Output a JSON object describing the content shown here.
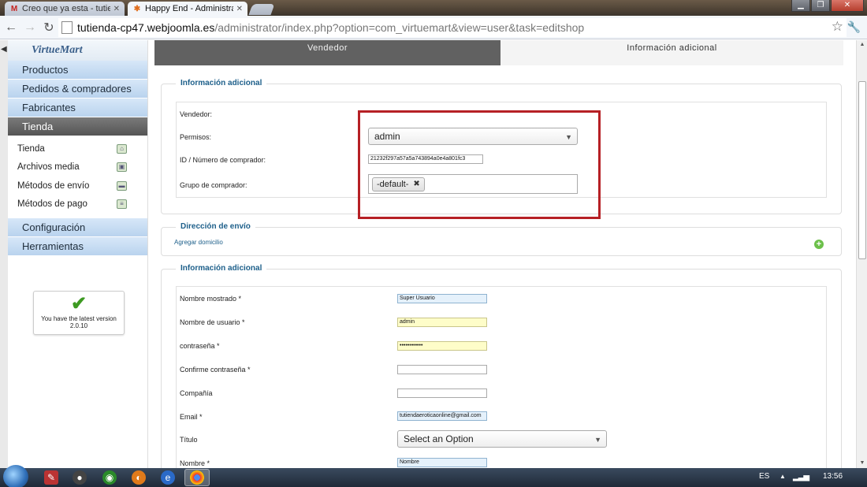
{
  "browser": {
    "tabs": [
      {
        "title": "Creo que ya esta - tutienda",
        "favicon": "gmail-icon",
        "active": false
      },
      {
        "title": "Happy End - Administración",
        "favicon": "joomla-icon",
        "active": true
      }
    ],
    "url_host": "tutienda-cp47.webjoomla.es",
    "url_path": "/administrator/index.php?option=com_virtuemart&view=user&task=editshop"
  },
  "sidebar": {
    "logo": "VirtueMart",
    "menu": [
      {
        "label": "Productos",
        "active": false
      },
      {
        "label": "Pedidos & compradores",
        "active": false
      },
      {
        "label": "Fabricantes",
        "active": false
      },
      {
        "label": "Tienda",
        "active": true
      }
    ],
    "submenu": [
      {
        "label": "Tienda",
        "icon": "store-icon"
      },
      {
        "label": "Archivos media",
        "icon": "media-icon"
      },
      {
        "label": "Métodos de envío",
        "icon": "truck-icon"
      },
      {
        "label": "Métodos de pago",
        "icon": "payment-icon"
      }
    ],
    "menu_bottom": [
      {
        "label": "Configuración"
      },
      {
        "label": "Herramientas"
      }
    ],
    "version_line1": "You have the latest version",
    "version_line2": "2.0.10"
  },
  "tabs": {
    "vendor": "Vendedor",
    "additional": "Información adicional"
  },
  "section1": {
    "legend": "Información adicional",
    "vendor_label": "Vendedor:",
    "permissions_label": "Permisos:",
    "permissions_value": "admin",
    "buyer_id_label": "ID / Número de comprador:",
    "buyer_id_value": "21232f297a57a5a743894a0e4a801fc3",
    "group_label": "Grupo de comprador:",
    "group_chip": "-default-"
  },
  "section2": {
    "legend": "Dirección de envío",
    "add_link": "Agregar domicilio"
  },
  "section3": {
    "legend": "Información adicional",
    "fields": {
      "display_name_label": "Nombre mostrado *",
      "display_name_value": "Super Usuario",
      "username_label": "Nombre de usuario *",
      "username_value": "admin",
      "password_label": "contraseña *",
      "password_value": "••••••••••••",
      "confirm_label": "Confirme contraseña *",
      "company_label": "Compañía",
      "email_label": "Email *",
      "email_value": "tutiendaeroticaonline@gmail.com",
      "title_label": "Título",
      "title_value": "Select an Option",
      "name_label": "Nombre *",
      "name_value": "Nombre"
    }
  },
  "taskbar": {
    "language": "ES",
    "time": "13:56"
  },
  "colors": {
    "highlight_box": "#b62025",
    "legend_text": "#1d5f8a",
    "sidebar_active": "#555555"
  }
}
